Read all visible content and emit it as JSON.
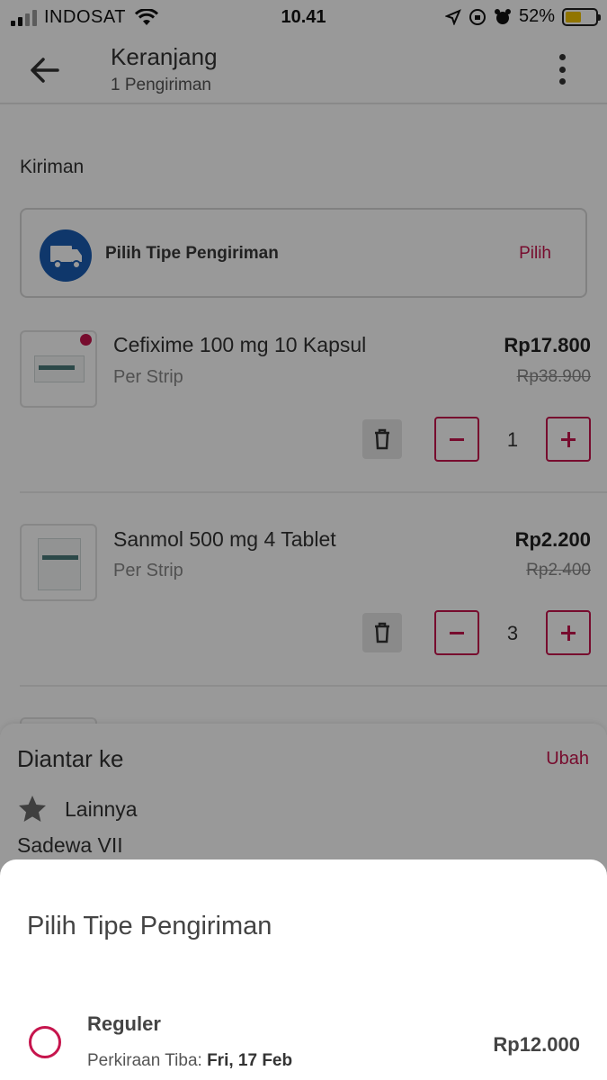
{
  "status_bar": {
    "carrier": "INDOSAT",
    "time": "10.41",
    "battery": "52%",
    "battery_level": 0.52
  },
  "header": {
    "title": "Keranjang",
    "subtitle": "1 Pengiriman"
  },
  "shipment": {
    "section_title": "Kiriman",
    "type_label": "Pilih Tipe Pengiriman",
    "type_action": "Pilih"
  },
  "items": [
    {
      "name": "Cefixime 100 mg 10 Kapsul",
      "unit": "Per Strip",
      "price": "Rp17.800",
      "original_price": "Rp38.900",
      "quantity": "1"
    },
    {
      "name": "Sanmol 500 mg 4 Tablet",
      "unit": "Per Strip",
      "price": "Rp2.200",
      "original_price": "Rp2.400",
      "quantity": "3"
    }
  ],
  "delivery": {
    "title": "Diantar ke",
    "action": "Ubah",
    "address_label": "Lainnya",
    "address_street": "Sadewa VII"
  },
  "sheet": {
    "title": "Pilih Tipe Pengiriman",
    "option_name": "Reguler",
    "eta_label": "Perkiraan Tiba: ",
    "eta_date": "Fri, 17 Feb",
    "option_price": "Rp12.000"
  },
  "colors": {
    "accent": "#c6154d",
    "truck_icon_bg": "#1a5db3",
    "battery_fill": "#f2c300"
  }
}
